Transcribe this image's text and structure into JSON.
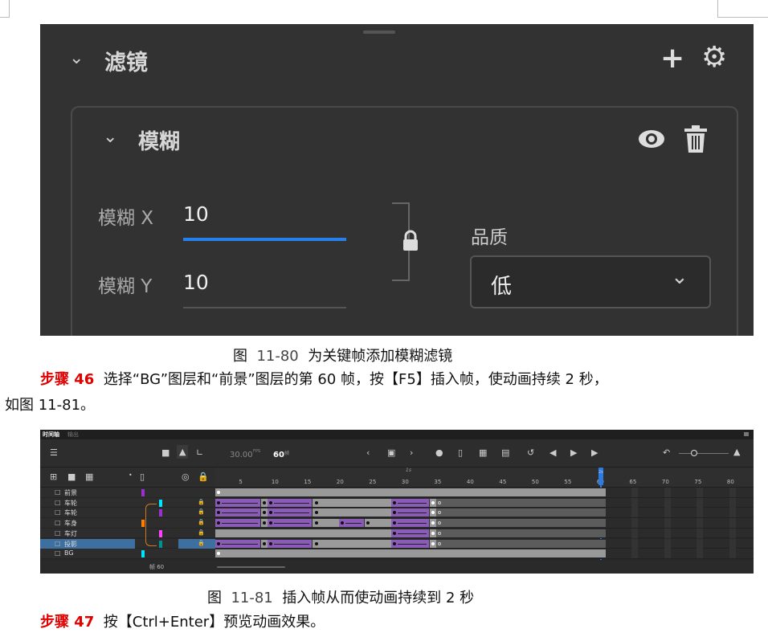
{
  "filter_panel": {
    "section_title": "滤镜",
    "filter_name": "模糊",
    "blur_x_label": "模糊 X",
    "blur_x_value": "10",
    "blur_y_label": "模糊 Y",
    "blur_y_value": "10",
    "quality_label": "品质",
    "quality_value": "低",
    "icons": [
      "chevron-down-icon",
      "plus-icon",
      "gear-icon",
      "eye-icon",
      "trash-icon",
      "lock-icon"
    ]
  },
  "caption1": {
    "prefix": "图",
    "number": "11-80",
    "text": "为关键帧添加模糊滤镜"
  },
  "step46": {
    "label": "步骤 46",
    "text": "选择“BG”图层和“前景”图层的第 60 帧，按【F5】插入帧，使动画持续 2 秒，",
    "text2": "如图 11-81。"
  },
  "timeline": {
    "tabs": [
      "时间轴",
      "输出"
    ],
    "fps": "30.00",
    "fps_unit": "FPS",
    "frame": "60",
    "frame_unit": "帧",
    "footer_frame": "帧 60",
    "ruler_seconds": [
      "1s",
      "2s"
    ],
    "ruler_ticks": [
      5,
      10,
      15,
      20,
      25,
      30,
      35,
      40,
      45,
      50,
      55,
      60,
      65,
      70,
      75,
      80
    ],
    "total_frames": 60,
    "current_frame": 60,
    "layers": [
      {
        "name": "前景",
        "color": "#9b30d0",
        "locked": false,
        "type": "static",
        "spans": [],
        "selected": false
      },
      {
        "name": "车轮",
        "color": "#00e5ff",
        "locked": true,
        "type": "anim",
        "spans": [
          [
            1,
            8
          ],
          [
            9,
            16
          ],
          [
            28,
            34
          ]
        ],
        "selected": false
      },
      {
        "name": "车轮",
        "color": "#9b30d0",
        "locked": true,
        "type": "anim",
        "spans": [
          [
            1,
            8
          ],
          [
            9,
            16
          ],
          [
            28,
            34
          ]
        ],
        "selected": false
      },
      {
        "name": "车身",
        "color": "#ff8000",
        "locked": true,
        "type": "anim",
        "spans": [
          [
            1,
            8
          ],
          [
            9,
            16
          ],
          [
            20,
            24
          ],
          [
            28,
            34
          ]
        ],
        "selected": false
      },
      {
        "name": "车灯",
        "color": "#ff40ff",
        "locked": true,
        "type": "anim",
        "spans": [
          [
            28,
            34
          ]
        ],
        "selected": false
      },
      {
        "name": "投影",
        "color": "#009090",
        "locked": true,
        "type": "anim",
        "spans": [
          [
            1,
            8
          ],
          [
            9,
            16
          ],
          [
            28,
            34
          ]
        ],
        "selected": true
      },
      {
        "name": "BG",
        "color": "#00e5ff",
        "locked": false,
        "type": "static",
        "spans": [],
        "selected": false
      }
    ]
  },
  "caption2": {
    "prefix": "图",
    "number": "11-81",
    "text": "插入帧从而使动画持续到 2 秒"
  },
  "step47": {
    "label": "步骤 47",
    "text": "按【Ctrl+Enter】预览动画效果。"
  }
}
